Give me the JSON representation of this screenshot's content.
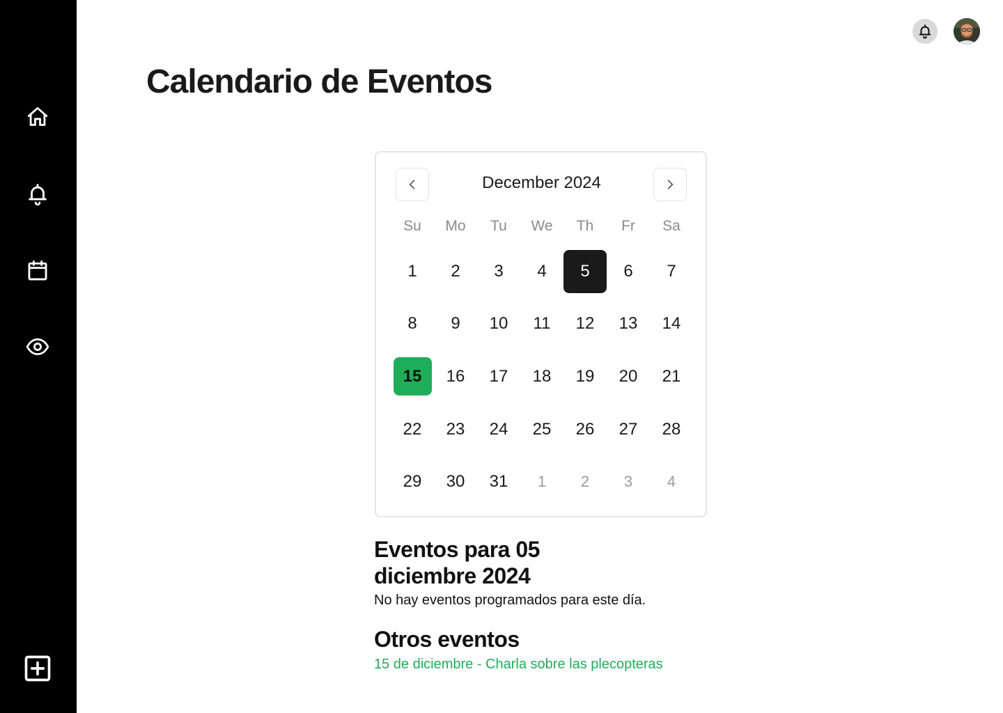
{
  "sidebar": {
    "items": [
      {
        "icon": "home-icon"
      },
      {
        "icon": "bell-icon"
      },
      {
        "icon": "calendar-icon"
      },
      {
        "icon": "eye-icon"
      }
    ],
    "add_icon": "plus-square-icon"
  },
  "topbar": {
    "notifications_icon": "bell-icon",
    "avatar": "user-avatar"
  },
  "page": {
    "title": "Calendario de Eventos"
  },
  "calendar": {
    "month_label": "December 2024",
    "prev_icon": "chevron-left-icon",
    "next_icon": "chevron-right-icon",
    "weekdays": [
      "Su",
      "Mo",
      "Tu",
      "We",
      "Th",
      "Fr",
      "Sa"
    ],
    "days": [
      "1",
      "2",
      "3",
      "4",
      "5",
      "6",
      "7",
      "8",
      "9",
      "10",
      "11",
      "12",
      "13",
      "14",
      "15",
      "16",
      "17",
      "18",
      "19",
      "20",
      "21",
      "22",
      "23",
      "24",
      "25",
      "26",
      "27",
      "28",
      "29",
      "30",
      "31",
      "1",
      "2",
      "3",
      "4"
    ],
    "selected_day": "5",
    "highlighted_day": "15"
  },
  "events": {
    "heading_prefix": "Eventos para",
    "heading_date": "05 diciembre 2024",
    "empty_message": "No hay eventos programados para este día.",
    "other_title": "Otros eventos",
    "other_items": [
      "15 de diciembre - Charla sobre las plecopteras"
    ]
  },
  "colors": {
    "sidebar_bg": "#000000",
    "accent_green": "#1fad5a",
    "selected_bg": "#1a1a1a"
  }
}
